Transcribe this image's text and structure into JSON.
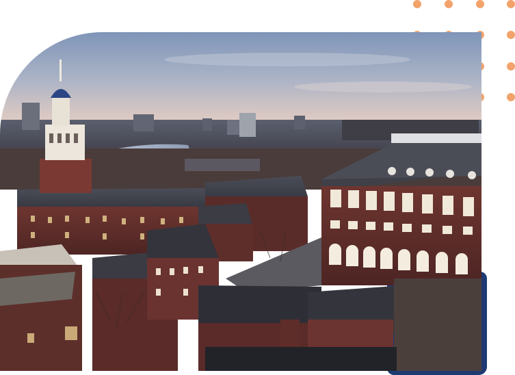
{
  "image": {
    "subject": "aerial-campus-dusk",
    "accent_color": "#1f3a73",
    "dot_color": "#f2a36b"
  },
  "decor": {
    "dot_rows": 4,
    "dot_cols": 4
  }
}
